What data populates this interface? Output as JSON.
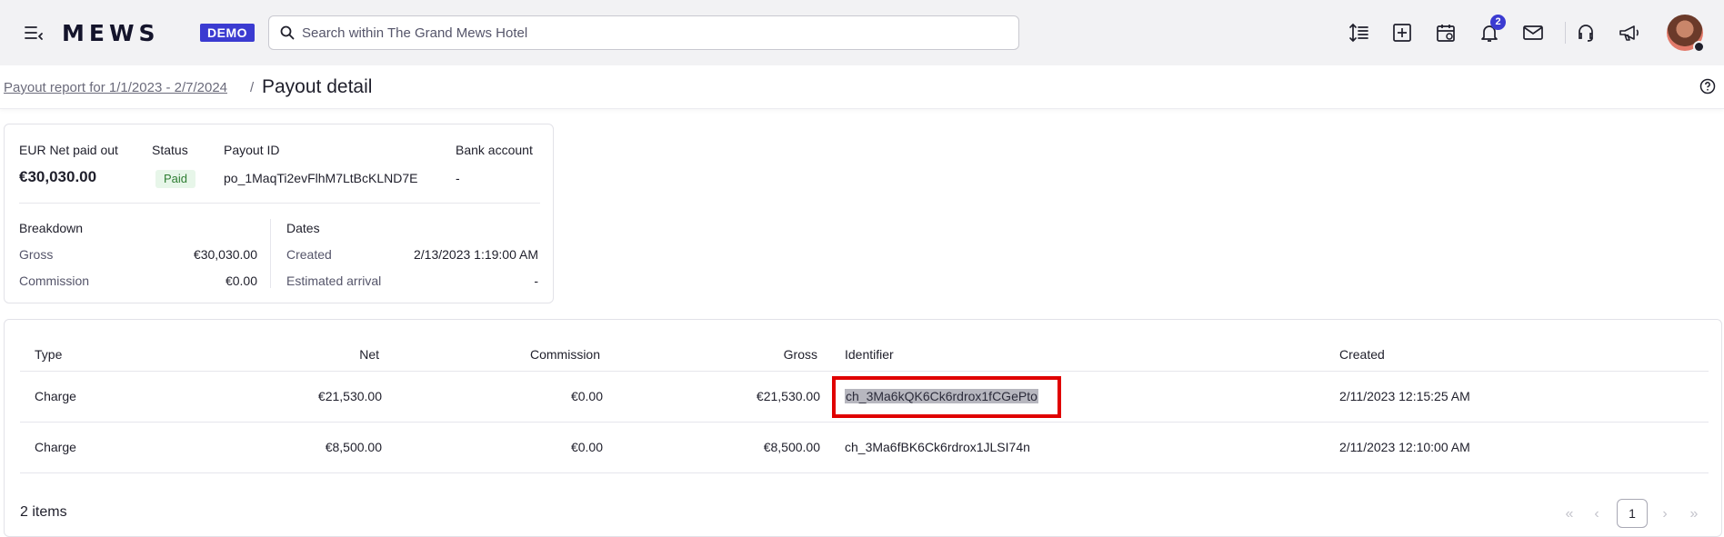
{
  "topbar": {
    "logo": "MEWS",
    "demo_badge": "DEMO",
    "search_placeholder": "Search within The Grand Mews Hotel",
    "notification_count": "2",
    "icons": [
      "menu-icon",
      "line-height-icon",
      "add-icon",
      "calendar-icon",
      "bell-icon",
      "mail-icon",
      "headset-icon",
      "megaphone-icon"
    ]
  },
  "header": {
    "breadcrumb_link": "Payout report for 1/1/2023 - 2/7/2024",
    "separator": "/",
    "title": "Payout detail"
  },
  "summary": {
    "net_label": "EUR Net paid out",
    "net_value": "€30,030.00",
    "status_label": "Status",
    "status_value": "Paid",
    "payout_id_label": "Payout ID",
    "payout_id_value": "po_1MaqTi2evFlhM7LtBcKLND7E",
    "bank_label": "Bank account",
    "bank_value": "-",
    "breakdown_label": "Breakdown",
    "gross_label": "Gross",
    "gross_value": "€30,030.00",
    "commission_label": "Commission",
    "commission_value": "€0.00",
    "dates_label": "Dates",
    "created_label": "Created",
    "created_value": "2/13/2023 1:19:00 AM",
    "arrival_label": "Estimated arrival",
    "arrival_value": "-"
  },
  "table": {
    "columns": [
      "Type",
      "Net",
      "Commission",
      "Gross",
      "Identifier",
      "Created"
    ],
    "rows": [
      {
        "type": "Charge",
        "net": "€21,530.00",
        "commission": "€0.00",
        "gross": "€21,530.00",
        "identifier": "ch_3Ma6kQK6Ck6rdrox1fCGePto",
        "created": "2/11/2023 12:15:25 AM"
      },
      {
        "type": "Charge",
        "net": "€8,500.00",
        "commission": "€0.00",
        "gross": "€8,500.00",
        "identifier": "ch_3Ma6fBK6Ck6rdrox1JLSI74n",
        "created": "2/11/2023 12:10:00 AM"
      }
    ],
    "items_count": "2 items",
    "pagination": {
      "first": "«",
      "prev": "‹",
      "current": "1",
      "next": "›",
      "last": "»"
    }
  },
  "colors": {
    "accent": "#3b3bd1",
    "highlight_box": "#e00000",
    "paid_bg": "#e7f6e9",
    "paid_text": "#2e7d32"
  }
}
